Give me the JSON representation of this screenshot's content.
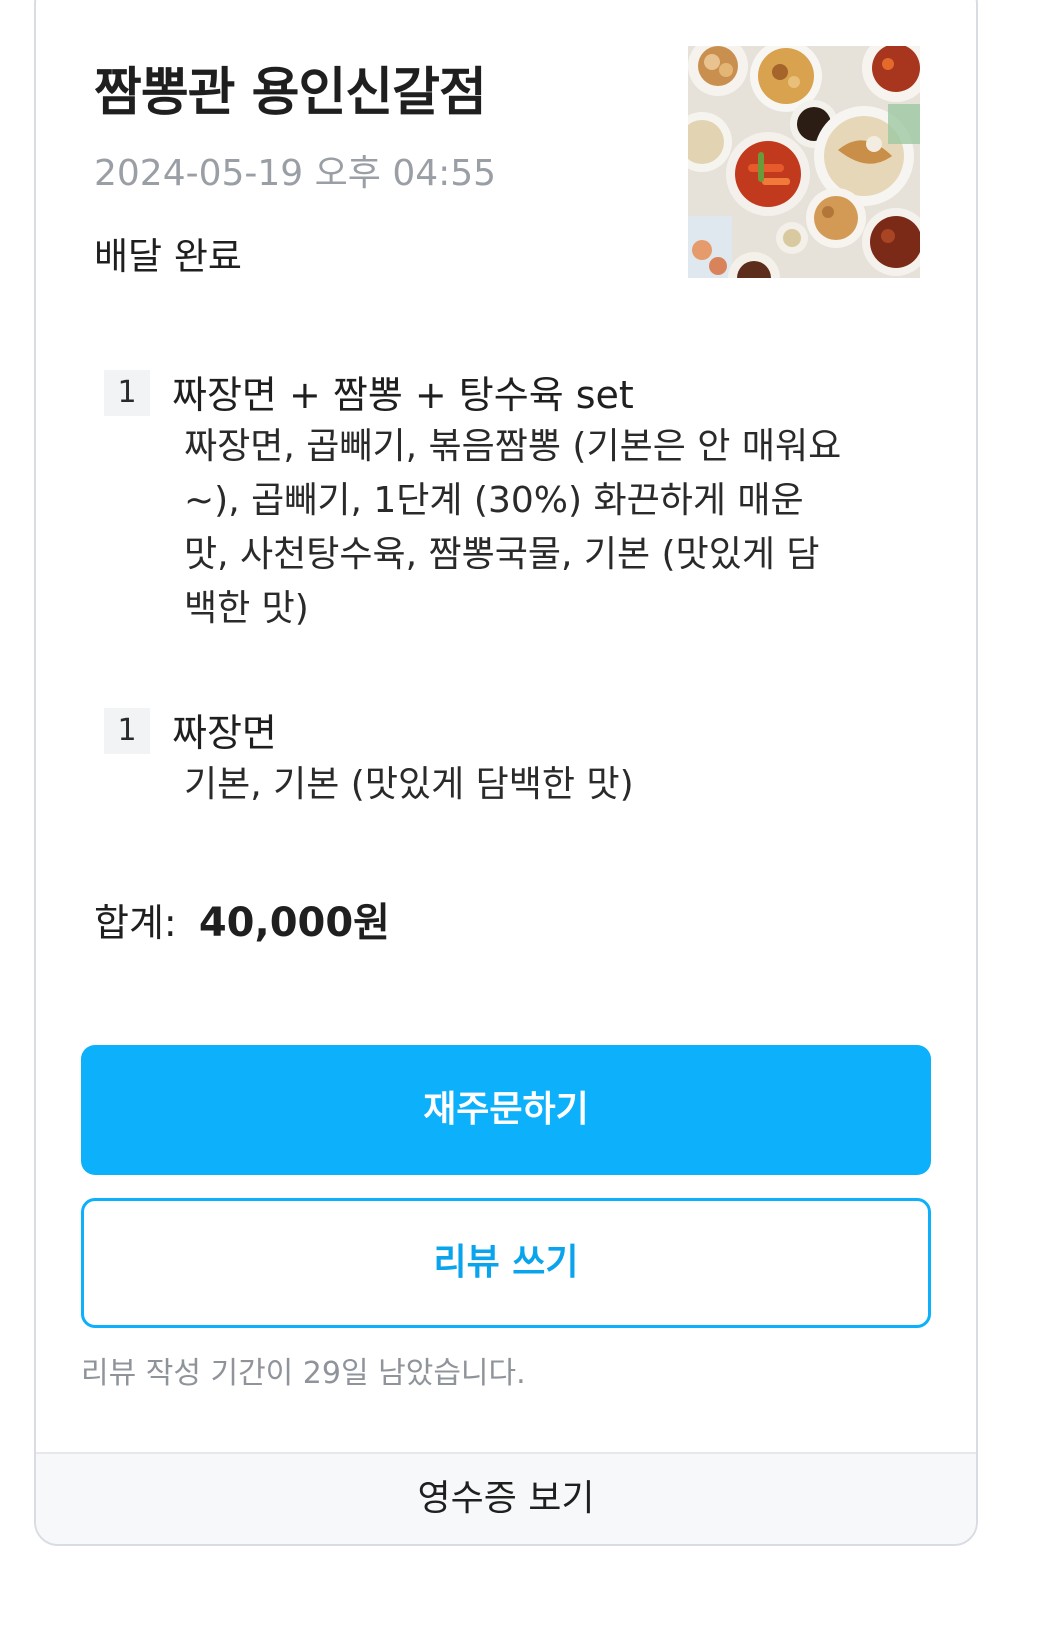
{
  "store": {
    "name": "짬뽕관 용인신갈점",
    "order_date": "2024-05-19 오후 04:55",
    "status": "배달 완료",
    "thumbnail_icon": "food-platter-image"
  },
  "items": [
    {
      "quantity": "1",
      "name": "짜장면 + 짬뽕 + 탕수육 set",
      "options": "짜장면, 곱빼기, 볶음짬뽕 (기본은 안 매워요~), 곱빼기, 1단계 (30%) 화끈하게 매운맛, 사천탕수육, 짬뽕국물, 기본 (맛있게 담백한 맛)"
    },
    {
      "quantity": "1",
      "name": "짜장면",
      "options": "기본, 기본 (맛있게 담백한 맛)"
    }
  ],
  "total": {
    "label": "합계:",
    "amount": "40,000원"
  },
  "actions": {
    "reorder_label": "재주문하기",
    "review_label": "리뷰 쓰기",
    "review_notice": "리뷰 작성 기간이 29일 남았습니다.",
    "receipt_label": "영수증 보기"
  },
  "colors": {
    "accent": "#0cb0fb",
    "muted_text": "#9a9ea5",
    "card_border": "#d9dde3"
  }
}
